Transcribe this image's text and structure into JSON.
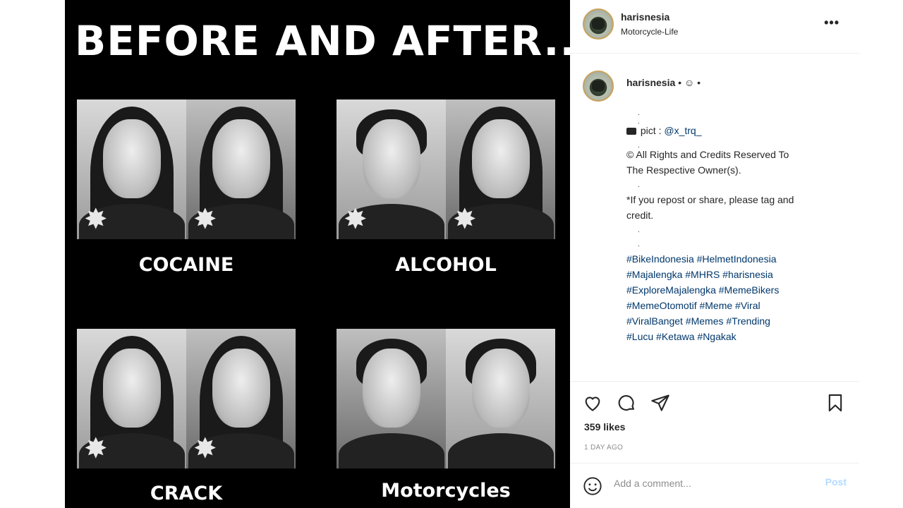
{
  "image": {
    "headline": "BEFORE AND AFTER...",
    "panels": [
      {
        "label": "COCAINE"
      },
      {
        "label": "ALCOHOL"
      },
      {
        "label": "CRACK"
      },
      {
        "label": "Motorcycles"
      }
    ]
  },
  "header": {
    "username": "harisnesia",
    "location": "Motorcycle-Life",
    "more_icon": "more-options-icon",
    "more_label": "•••"
  },
  "caption": {
    "username": "harisnesia",
    "after_name": " • ☺ •",
    "lines": [
      ".",
      ".",
      "",
      ".",
      "© All Rights and Credits Reserved To",
      "The Respective Owner(s).",
      ".",
      "*If you repost or share, please tag and",
      "credit.",
      ".",
      "."
    ],
    "pict_prefix": " pict : ",
    "pict_handle": "@x_trq_",
    "hashtag_lines": [
      "#BikeIndonesia #HelmetIndonesia",
      "#Majalengka #MHRS #harisnesia",
      "#ExploreMajalengka #MemeBikers",
      "#MemeOtomotif #Meme #Viral",
      "#ViralBanget #Memes #Trending",
      "#Lucu #Ketawa #Ngakak"
    ]
  },
  "actions": {
    "likes": "359 likes",
    "time": "1 DAY AGO"
  },
  "comment": {
    "placeholder": "Add a comment...",
    "post_label": "Post"
  }
}
